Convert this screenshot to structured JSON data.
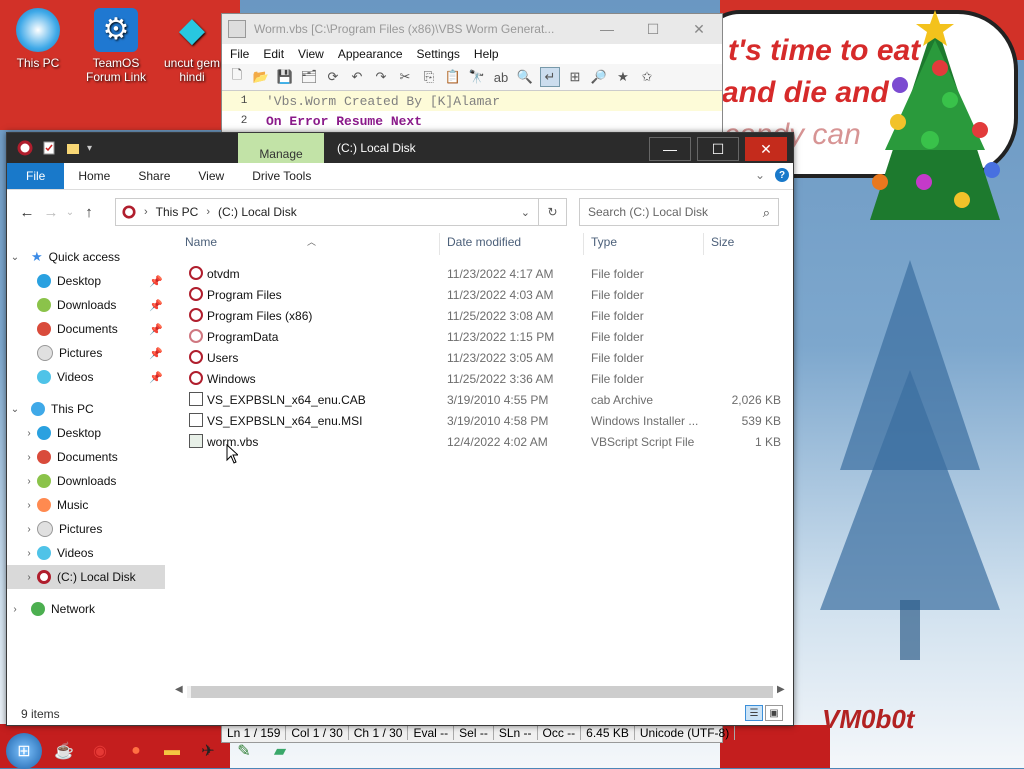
{
  "desktop": {
    "icons": [
      {
        "label": "This PC"
      },
      {
        "label": "TeamOS Forum Link"
      },
      {
        "label": "uncut gem hindi"
      }
    ],
    "wallpaper_text": {
      "line1": "t's time to eat",
      "line2": "and die and",
      "line3": "candy can"
    },
    "signature": "VM0b0t"
  },
  "notepad": {
    "title": "Worm.vbs [C:\\Program Files (x86)\\VBS Worm Generat...",
    "menu": [
      "File",
      "Edit",
      "View",
      "Appearance",
      "Settings",
      "Help"
    ],
    "lines": [
      {
        "num": "1",
        "text": "'Vbs.Worm Created By [K]Alamar",
        "kind": "comment"
      },
      {
        "num": "2",
        "text": "On Error Resume Next",
        "kind": "keyword"
      }
    ],
    "status": [
      "Ln 1 / 159",
      "Col 1 / 30",
      "Ch 1 / 30",
      "Eval --",
      "Sel --",
      "SLn --",
      "Occ --",
      "6.45 KB",
      "Unicode (UTF-8)"
    ]
  },
  "explorer": {
    "manage_tab": "Manage",
    "title": "(C:) Local Disk",
    "ribbon_tabs": [
      "File",
      "Home",
      "Share",
      "View",
      "Drive Tools"
    ],
    "address": {
      "segments": [
        "This PC",
        "(C:) Local Disk"
      ]
    },
    "search": {
      "placeholder": "Search (C:) Local Disk"
    },
    "nav": {
      "quick_access": "Quick access",
      "quick_items": [
        "Desktop",
        "Downloads",
        "Documents",
        "Pictures",
        "Videos"
      ],
      "this_pc": "This PC",
      "pc_items": [
        "Desktop",
        "Documents",
        "Downloads",
        "Music",
        "Pictures",
        "Videos",
        "(C:) Local Disk"
      ],
      "network": "Network"
    },
    "columns": {
      "name": "Name",
      "date": "Date modified",
      "type": "Type",
      "size": "Size"
    },
    "files": [
      {
        "name": "otvdm",
        "date": "11/23/2022 4:17 AM",
        "type": "File folder",
        "size": "",
        "kind": "folder"
      },
      {
        "name": "Program Files",
        "date": "11/23/2022 4:03 AM",
        "type": "File folder",
        "size": "",
        "kind": "folder"
      },
      {
        "name": "Program Files (x86)",
        "date": "11/25/2022 3:08 AM",
        "type": "File folder",
        "size": "",
        "kind": "folder"
      },
      {
        "name": "ProgramData",
        "date": "11/23/2022 1:15 PM",
        "type": "File folder",
        "size": "",
        "kind": "folder"
      },
      {
        "name": "Users",
        "date": "11/23/2022 3:05 AM",
        "type": "File folder",
        "size": "",
        "kind": "folder"
      },
      {
        "name": "Windows",
        "date": "11/25/2022 3:36 AM",
        "type": "File folder",
        "size": "",
        "kind": "folder"
      },
      {
        "name": "VS_EXPBSLN_x64_enu.CAB",
        "date": "3/19/2010 4:55 PM",
        "type": "cab Archive",
        "size": "2,026 KB",
        "kind": "file"
      },
      {
        "name": "VS_EXPBSLN_x64_enu.MSI",
        "date": "3/19/2010 4:58 PM",
        "type": "Windows Installer ...",
        "size": "539 KB",
        "kind": "file"
      },
      {
        "name": "worm.vbs",
        "date": "12/4/2022 4:02 AM",
        "type": "VBScript Script File",
        "size": "1 KB",
        "kind": "script"
      }
    ],
    "status": "9 items"
  },
  "colors": {
    "accent": "#1979ca",
    "manage": "#c2e3a7",
    "close": "#c42b1c"
  }
}
